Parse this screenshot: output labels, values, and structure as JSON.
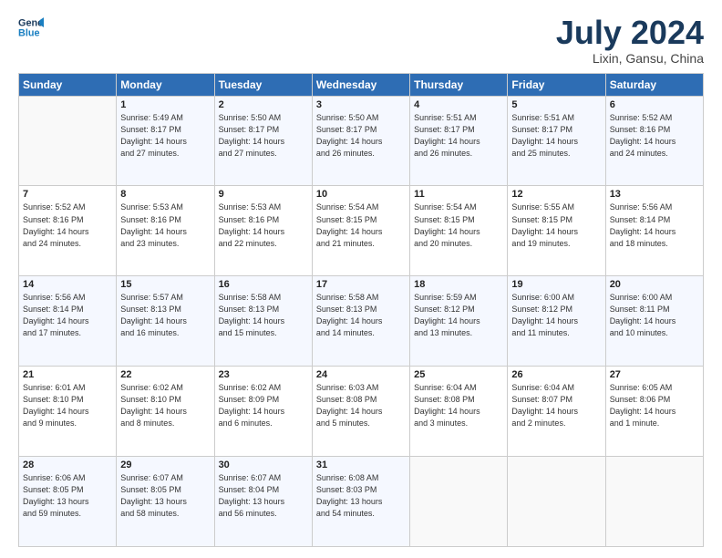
{
  "header": {
    "logo_line1": "General",
    "logo_line2": "Blue",
    "month_title": "July 2024",
    "location": "Lixin, Gansu, China"
  },
  "weekdays": [
    "Sunday",
    "Monday",
    "Tuesday",
    "Wednesday",
    "Thursday",
    "Friday",
    "Saturday"
  ],
  "weeks": [
    [
      {
        "day": "",
        "info": ""
      },
      {
        "day": "1",
        "info": "Sunrise: 5:49 AM\nSunset: 8:17 PM\nDaylight: 14 hours\nand 27 minutes."
      },
      {
        "day": "2",
        "info": "Sunrise: 5:50 AM\nSunset: 8:17 PM\nDaylight: 14 hours\nand 27 minutes."
      },
      {
        "day": "3",
        "info": "Sunrise: 5:50 AM\nSunset: 8:17 PM\nDaylight: 14 hours\nand 26 minutes."
      },
      {
        "day": "4",
        "info": "Sunrise: 5:51 AM\nSunset: 8:17 PM\nDaylight: 14 hours\nand 26 minutes."
      },
      {
        "day": "5",
        "info": "Sunrise: 5:51 AM\nSunset: 8:17 PM\nDaylight: 14 hours\nand 25 minutes."
      },
      {
        "day": "6",
        "info": "Sunrise: 5:52 AM\nSunset: 8:16 PM\nDaylight: 14 hours\nand 24 minutes."
      }
    ],
    [
      {
        "day": "7",
        "info": "Sunrise: 5:52 AM\nSunset: 8:16 PM\nDaylight: 14 hours\nand 24 minutes."
      },
      {
        "day": "8",
        "info": "Sunrise: 5:53 AM\nSunset: 8:16 PM\nDaylight: 14 hours\nand 23 minutes."
      },
      {
        "day": "9",
        "info": "Sunrise: 5:53 AM\nSunset: 8:16 PM\nDaylight: 14 hours\nand 22 minutes."
      },
      {
        "day": "10",
        "info": "Sunrise: 5:54 AM\nSunset: 8:15 PM\nDaylight: 14 hours\nand 21 minutes."
      },
      {
        "day": "11",
        "info": "Sunrise: 5:54 AM\nSunset: 8:15 PM\nDaylight: 14 hours\nand 20 minutes."
      },
      {
        "day": "12",
        "info": "Sunrise: 5:55 AM\nSunset: 8:15 PM\nDaylight: 14 hours\nand 19 minutes."
      },
      {
        "day": "13",
        "info": "Sunrise: 5:56 AM\nSunset: 8:14 PM\nDaylight: 14 hours\nand 18 minutes."
      }
    ],
    [
      {
        "day": "14",
        "info": "Sunrise: 5:56 AM\nSunset: 8:14 PM\nDaylight: 14 hours\nand 17 minutes."
      },
      {
        "day": "15",
        "info": "Sunrise: 5:57 AM\nSunset: 8:13 PM\nDaylight: 14 hours\nand 16 minutes."
      },
      {
        "day": "16",
        "info": "Sunrise: 5:58 AM\nSunset: 8:13 PM\nDaylight: 14 hours\nand 15 minutes."
      },
      {
        "day": "17",
        "info": "Sunrise: 5:58 AM\nSunset: 8:13 PM\nDaylight: 14 hours\nand 14 minutes."
      },
      {
        "day": "18",
        "info": "Sunrise: 5:59 AM\nSunset: 8:12 PM\nDaylight: 14 hours\nand 13 minutes."
      },
      {
        "day": "19",
        "info": "Sunrise: 6:00 AM\nSunset: 8:12 PM\nDaylight: 14 hours\nand 11 minutes."
      },
      {
        "day": "20",
        "info": "Sunrise: 6:00 AM\nSunset: 8:11 PM\nDaylight: 14 hours\nand 10 minutes."
      }
    ],
    [
      {
        "day": "21",
        "info": "Sunrise: 6:01 AM\nSunset: 8:10 PM\nDaylight: 14 hours\nand 9 minutes."
      },
      {
        "day": "22",
        "info": "Sunrise: 6:02 AM\nSunset: 8:10 PM\nDaylight: 14 hours\nand 8 minutes."
      },
      {
        "day": "23",
        "info": "Sunrise: 6:02 AM\nSunset: 8:09 PM\nDaylight: 14 hours\nand 6 minutes."
      },
      {
        "day": "24",
        "info": "Sunrise: 6:03 AM\nSunset: 8:08 PM\nDaylight: 14 hours\nand 5 minutes."
      },
      {
        "day": "25",
        "info": "Sunrise: 6:04 AM\nSunset: 8:08 PM\nDaylight: 14 hours\nand 3 minutes."
      },
      {
        "day": "26",
        "info": "Sunrise: 6:04 AM\nSunset: 8:07 PM\nDaylight: 14 hours\nand 2 minutes."
      },
      {
        "day": "27",
        "info": "Sunrise: 6:05 AM\nSunset: 8:06 PM\nDaylight: 14 hours\nand 1 minute."
      }
    ],
    [
      {
        "day": "28",
        "info": "Sunrise: 6:06 AM\nSunset: 8:05 PM\nDaylight: 13 hours\nand 59 minutes."
      },
      {
        "day": "29",
        "info": "Sunrise: 6:07 AM\nSunset: 8:05 PM\nDaylight: 13 hours\nand 58 minutes."
      },
      {
        "day": "30",
        "info": "Sunrise: 6:07 AM\nSunset: 8:04 PM\nDaylight: 13 hours\nand 56 minutes."
      },
      {
        "day": "31",
        "info": "Sunrise: 6:08 AM\nSunset: 8:03 PM\nDaylight: 13 hours\nand 54 minutes."
      },
      {
        "day": "",
        "info": ""
      },
      {
        "day": "",
        "info": ""
      },
      {
        "day": "",
        "info": ""
      }
    ]
  ]
}
